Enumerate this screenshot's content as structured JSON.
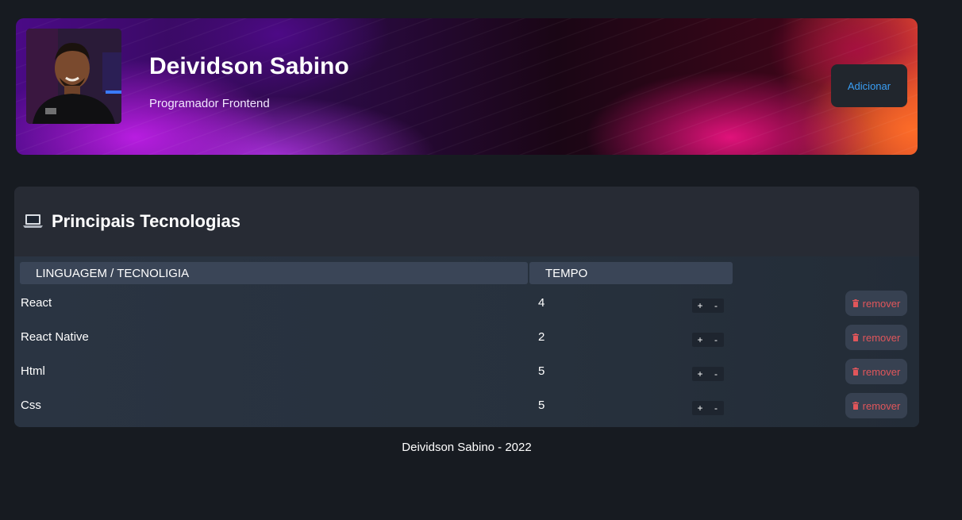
{
  "profile": {
    "name": "Deividson Sabino",
    "role": "Programador Frontend",
    "add_label": "Adicionar"
  },
  "tech_section": {
    "icon": "laptop-icon",
    "title": "Principais Tecnologias",
    "columns": [
      "LINGUAGEM / TECNOLIGIA",
      "TEMPO"
    ],
    "rows": [
      {
        "tech": "React",
        "years": "4"
      },
      {
        "tech": "React Native",
        "years": "2"
      },
      {
        "tech": "Html",
        "years": "5"
      },
      {
        "tech": "Css",
        "years": "5"
      }
    ],
    "increment_label": "+",
    "decrement_label": "-",
    "remove_label": "remover",
    "remove_icon": "trash-icon"
  },
  "footer": {
    "text": "Deividson Sabino - 2022"
  },
  "colors": {
    "background": "#171b21",
    "accent_blue": "#3a9ff5",
    "remove_red": "#e0565b",
    "header_cell": "#3a4557"
  }
}
